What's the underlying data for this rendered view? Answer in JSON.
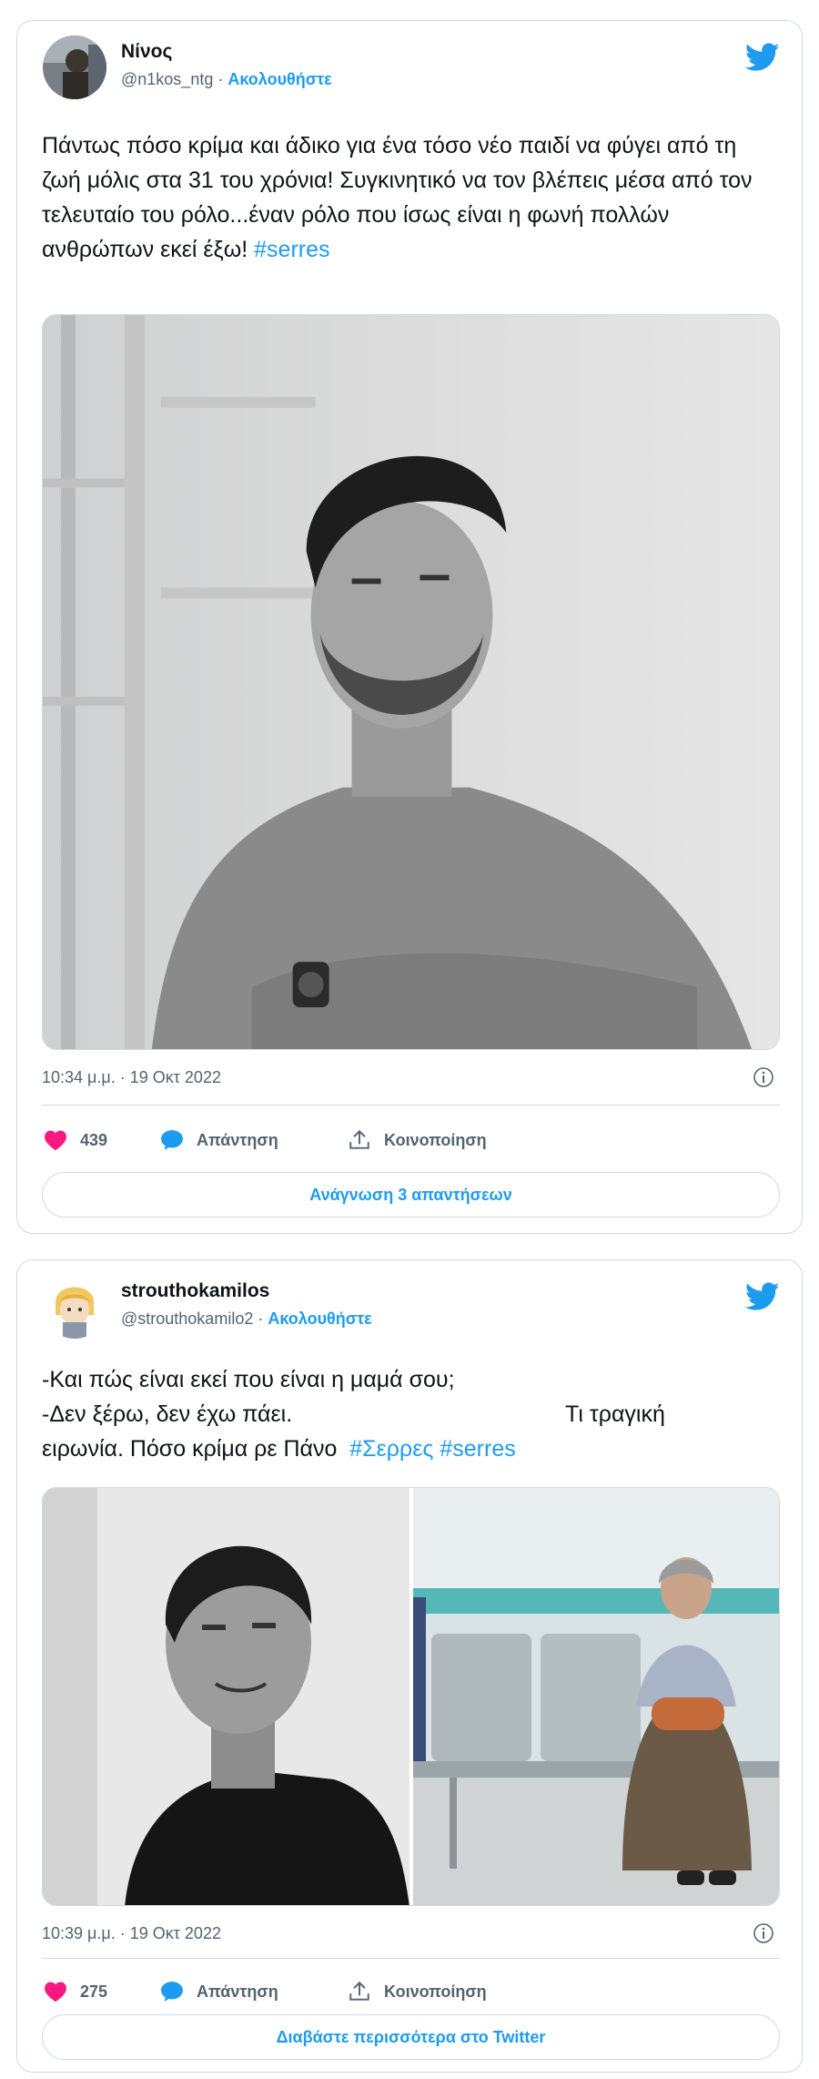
{
  "colors": {
    "accent": "#1d9bf0",
    "like": "#f91880",
    "text": "#0f1419",
    "muted": "#536471"
  },
  "tweets": [
    {
      "name": "Νίνος",
      "handle": "@n1kos_ntg",
      "follow": "Ακολουθήστε",
      "text": "Πάντως πόσο κρίμα και άδικο για ένα τόσο νέο παιδί να φύγει από τη ζωή μόλις στα 31 του χρόνια! Συγκινητικό να τον βλέπεις μέσα από τον τελευταίο του ρόλο...έναν ρόλο που ίσως είναι η φωνή πολλών ανθρώπων εκεί έξω! ",
      "hashtags": "#serres",
      "timestamp": "10:34 μ.μ. · 19 Οκτ 2022",
      "likes": "439",
      "reply": "Απάντηση",
      "share": "Κοινοποίηση",
      "cta": "Ανάγνωση 3 απαντήσεων"
    },
    {
      "name": "strouthokamilos",
      "handle": "@strouthokamilo2",
      "follow": "Ακολουθήστε",
      "text_line1": "-Και πώς είναι εκεί που είναι η μαμά σου;",
      "text_line2a": "-Δεν ξέρω, δεν έχω πάει.",
      "text_line2b": "Τι τραγική",
      "text_line3": "ειρωνία. Πόσο κρίμα ρε Πάνο  ",
      "hashtags": "#Σερρες #serres",
      "timestamp": "10:39 μ.μ. · 19 Οκτ 2022",
      "likes": "275",
      "reply": "Απάντηση",
      "share": "Κοινοποίηση",
      "cta": "Διαβάστε περισσότερα στο Twitter"
    }
  ]
}
